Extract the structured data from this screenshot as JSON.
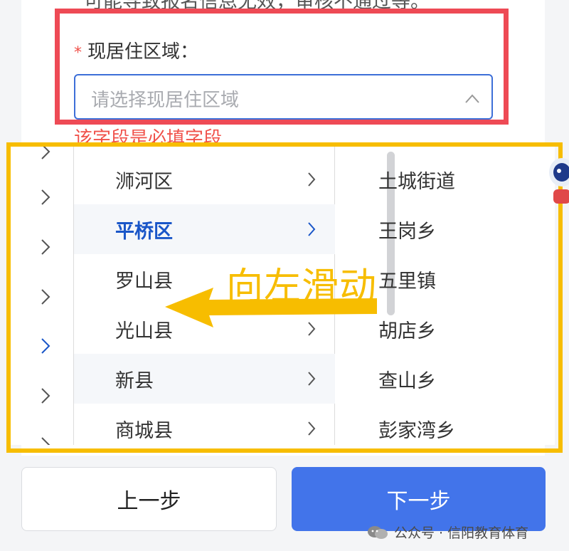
{
  "top_note": "可能导致报名信息无效，审核不通过等。",
  "field": {
    "required_mark": "*",
    "label": "现居住区域：",
    "placeholder": "请选择现居住区域",
    "error": "该字段是必填字段"
  },
  "picker": {
    "districts": [
      {
        "name": "浉河区",
        "selected": false
      },
      {
        "name": "平桥区",
        "selected": true
      },
      {
        "name": "罗山县",
        "selected": false
      },
      {
        "name": "光山县",
        "selected": false
      },
      {
        "name": "新县",
        "selected": false
      },
      {
        "name": "商城县",
        "selected": false
      }
    ],
    "towns": [
      "土城街道",
      "王岗乡",
      "五里镇",
      "胡店乡",
      "查山乡",
      "彭家湾乡"
    ]
  },
  "annotation": "向左滑动",
  "buttons": {
    "prev": "上一步",
    "next": "下一步"
  },
  "watermark": "公众号 · 信阳教育体育",
  "colors": {
    "accent": "#4274ea",
    "selected_text": "#1a56c8",
    "error": "#f0524b",
    "annotation_yellow": "#f7bd00",
    "frame_red": "#ee4a55"
  }
}
